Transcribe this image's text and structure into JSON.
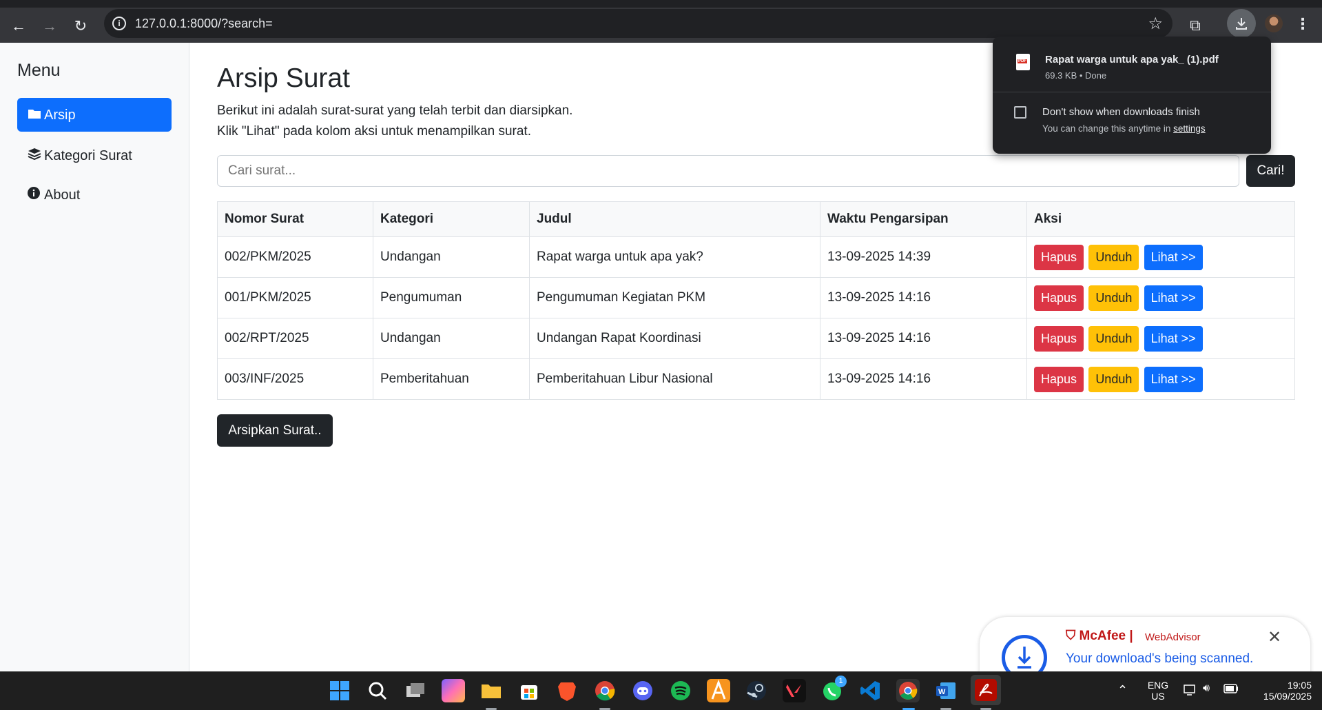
{
  "browser": {
    "url": "127.0.0.1:8000/?search="
  },
  "sidebar": {
    "title": "Menu",
    "items": [
      {
        "label": "Arsip",
        "icon": "folder-icon",
        "active": true
      },
      {
        "label": "Kategori Surat",
        "icon": "layers-icon",
        "active": false
      },
      {
        "label": "About",
        "icon": "info-icon",
        "active": false
      }
    ]
  },
  "main": {
    "title": "Arsip Surat",
    "description_line1": "Berikut ini adalah surat-surat yang telah terbit dan diarsipkan.",
    "description_line2": "Klik \"Lihat\" pada kolom aksi untuk menampilkan surat.",
    "search": {
      "placeholder": "Cari surat...",
      "value": "",
      "button_label": "Cari!"
    },
    "table": {
      "headers": [
        "Nomor Surat",
        "Kategori",
        "Judul",
        "Waktu Pengarsipan",
        "Aksi"
      ],
      "rows": [
        {
          "nomor": "002/PKM/2025",
          "kategori": "Undangan",
          "judul": "Rapat warga untuk apa yak?",
          "waktu": "13-09-2025 14:39"
        },
        {
          "nomor": "001/PKM/2025",
          "kategori": "Pengumuman",
          "judul": "Pengumuman Kegiatan PKM",
          "waktu": "13-09-2025 14:16"
        },
        {
          "nomor": "002/RPT/2025",
          "kategori": "Undangan",
          "judul": "Undangan Rapat Koordinasi",
          "waktu": "13-09-2025 14:16"
        },
        {
          "nomor": "003/INF/2025",
          "kategori": "Pemberitahuan",
          "judul": "Pemberitahuan Libur Nasional",
          "waktu": "13-09-2025 14:16"
        }
      ],
      "actions": {
        "delete": "Hapus",
        "download": "Unduh",
        "view": "Lihat >>"
      }
    },
    "archive_button": "Arsipkan Surat.."
  },
  "download_panel": {
    "file_name": "Rapat warga untuk apa yak_ (1).pdf",
    "meta": "69.3 KB • Done",
    "checkbox_label": "Don't show when downloads finish",
    "note": "You can change this anytime in",
    "note_link": "settings"
  },
  "mcafee": {
    "brand": "McAfee",
    "product": "WebAdvisor",
    "message": "Your download's being scanned."
  },
  "taskbar": {
    "lang": "ENG",
    "region": "US",
    "time": "19:05",
    "date": "15/09/2025",
    "whatsapp_badge": "1"
  },
  "colors": {
    "primary": "#0d6efd",
    "danger": "#dc3545",
    "warning": "#ffc107",
    "dark": "#212529"
  }
}
